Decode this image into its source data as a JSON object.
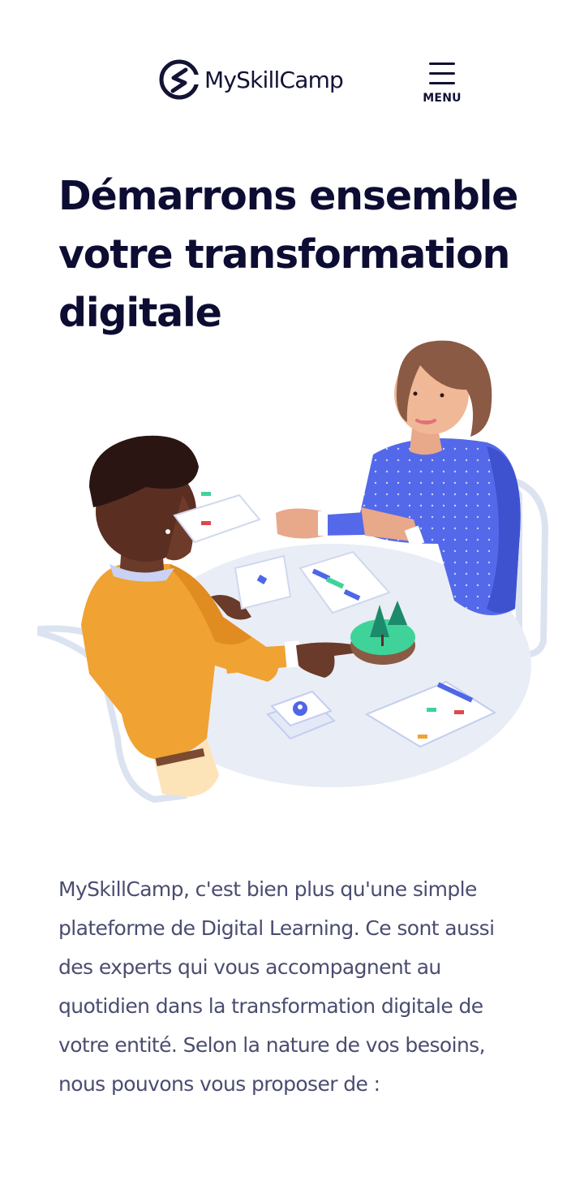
{
  "header": {
    "brand_name": "MySkillCamp",
    "logo_icon": "myskillcamp-logo-icon",
    "menu_icon": "hamburger-icon",
    "menu_label": "MENU"
  },
  "hero": {
    "title": "Démarrons ensemble votre transformation digitale",
    "illustration": "two-people-meeting-at-table-illustration"
  },
  "content": {
    "intro": "MySkillCamp, c'est bien plus qu'une simple plateforme de Digital Learning. Ce sont aussi des experts qui vous accompagnent au quotidien dans la transformation digitale de votre entité. Selon la nature de vos besoins, nous pouvons vous proposer de :"
  },
  "colors": {
    "heading": "#0d0d33",
    "body_text": "#4a4d70",
    "accent_blue": "#4f66e8",
    "accent_orange": "#f0a232",
    "accent_green": "#3fd39a",
    "table": "#e9edf5"
  }
}
